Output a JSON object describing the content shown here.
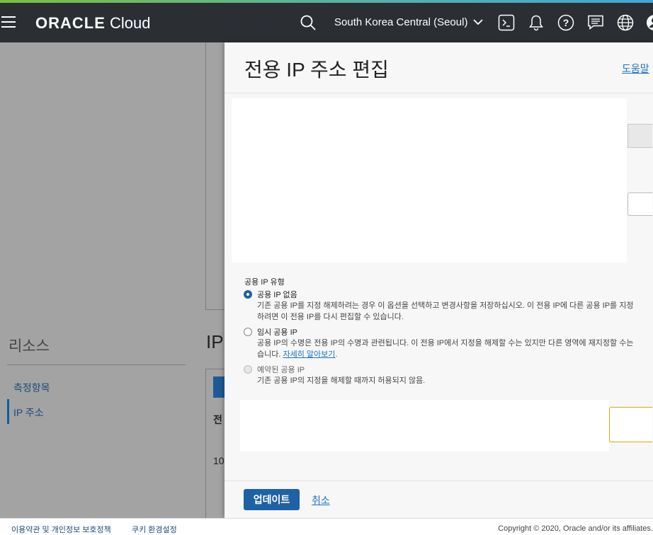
{
  "topbar": {
    "logo_brand": "ORACLE",
    "logo_product": "Cloud",
    "region": "South Korea Central (Seoul)",
    "icons": [
      "menu-icon",
      "search-icon",
      "chevron-down-icon",
      "cloud-shell-icon",
      "bell-icon",
      "help-icon",
      "chat-icon",
      "globe-icon",
      "profile-icon"
    ],
    "accent_bar_colors": [
      "#7bbf3f",
      "#3fa7d6"
    ]
  },
  "background": {
    "resources_title": "리소스",
    "resources_items": [
      {
        "label": "측정항목",
        "active": false
      },
      {
        "label": "IP 주소",
        "active": true
      }
    ],
    "ip_heading": "IP",
    "table_header_initial": "전",
    "table_cell_initial": "10"
  },
  "panel": {
    "title": "전용 IP 주소 편집",
    "help_link": "도움말",
    "ip_type_label": "공용 IP 유형",
    "options": [
      {
        "label": "공용 IP 없음",
        "desc_line1": "기존 공용 IP를 지정 해제하려는 경우 이 옵션을 선택하고 변경사항을 저장하십시오. 이 전용 IP에 다른 공용 IP를 지정",
        "desc_line2": "하려면 이 전용 IP를 다시 편집할 수 있습니다.",
        "checked": true,
        "disabled": false
      },
      {
        "label": "임시 공용 IP",
        "desc_line1": "공용 IP의 수명은 전용 IP의 수명과 관련됩니다. 이 전용 IP에서 지정을 해제할 수는 있지만 다른 영역에 재지정할 수는",
        "desc_line2": "습니다.",
        "link": "자세히 알아보기",
        "desc_suffix": ".",
        "checked": false,
        "disabled": false
      },
      {
        "label": "예약된 공용 IP",
        "desc_line1": "기존 공용 IP의 지정을 해제할 때까지 허용되지 않음.",
        "checked": false,
        "disabled": true
      }
    ],
    "update_button": "업데이트",
    "cancel_link": "취소"
  },
  "footer": {
    "terms_link": "이용약관 및 개인정보 보호정책",
    "cookie_link": "쿠키 환경설정",
    "copyright": "Copyright © 2020, Oracle and/or its affiliates."
  },
  "colors": {
    "primary": "#1f61a5",
    "link": "#1a73c7",
    "topbar": "#2b2f33",
    "overlay": "#a3a3a3",
    "warning_border": "#e0a800"
  }
}
